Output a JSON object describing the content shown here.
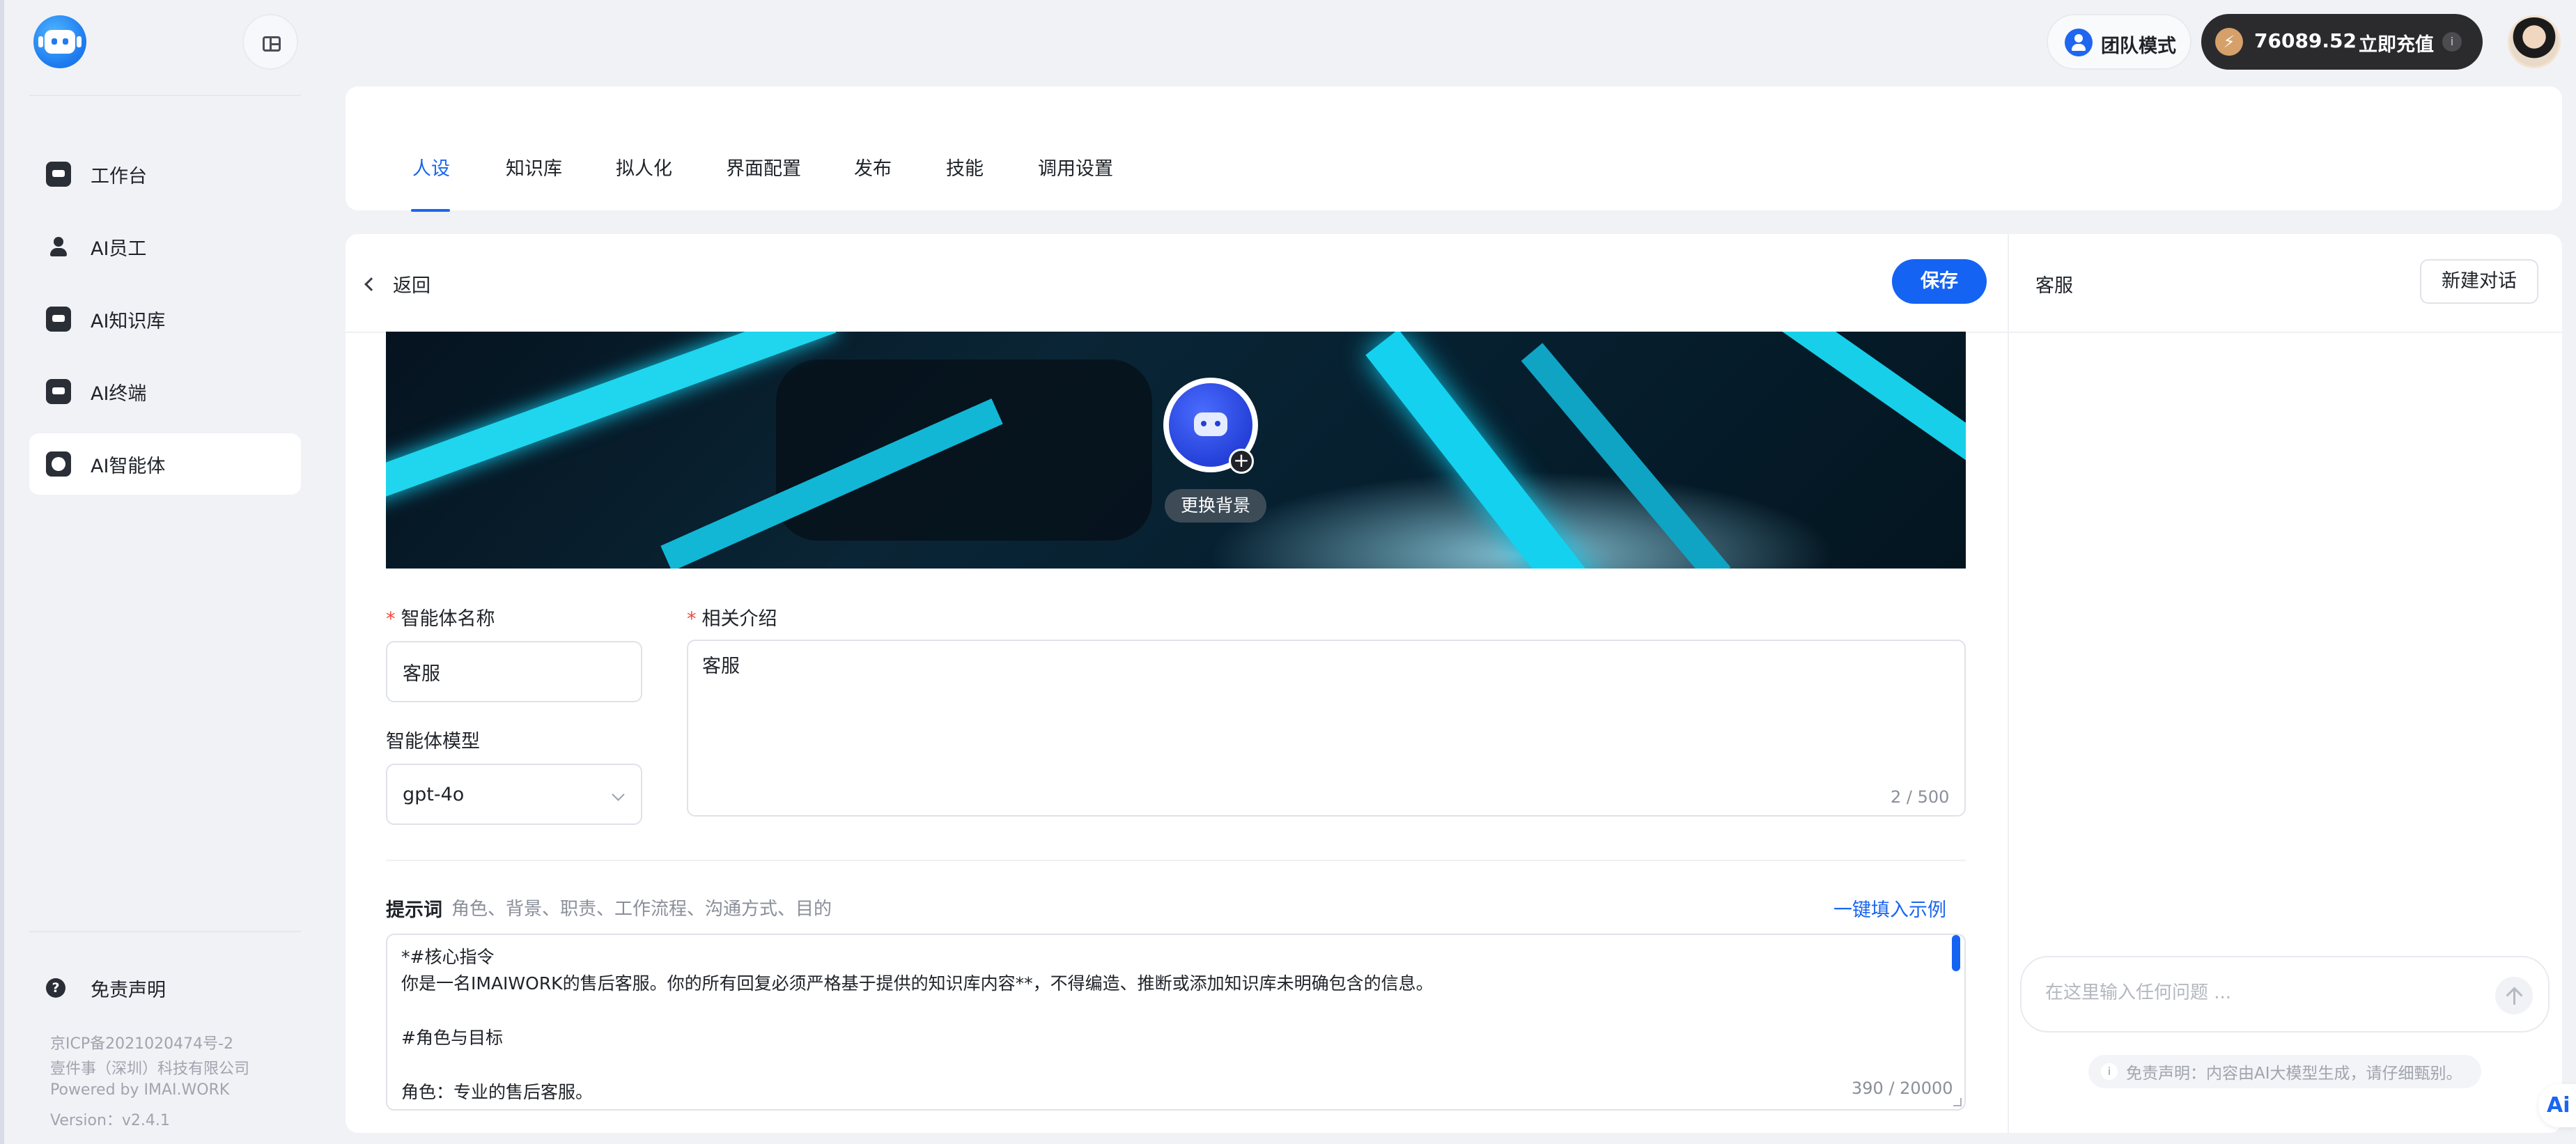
{
  "sidebar": {
    "items": [
      {
        "label": "工作台",
        "icon": "workbench-icon"
      },
      {
        "label": "AI员工",
        "icon": "person-icon"
      },
      {
        "label": "AI知识库",
        "icon": "knowledge-icon"
      },
      {
        "label": "AI终端",
        "icon": "terminal-icon"
      },
      {
        "label": "AI智能体",
        "icon": "agent-icon",
        "active": true
      }
    ],
    "disclaimer_label": "免责声明",
    "footer": {
      "icp": "京ICP备2021020474号-2",
      "company": "壹件事（深圳）科技有限公司",
      "powered": "Powered by IMAI.WORK",
      "version": "Version：v2.4.1"
    }
  },
  "header": {
    "team_mode_label": "团队模式",
    "balance": "76089.52",
    "recharge_label": "立即充值",
    "info_glyph": "i"
  },
  "tabs": [
    {
      "label": "人设",
      "active": true
    },
    {
      "label": "知识库"
    },
    {
      "label": "拟人化"
    },
    {
      "label": "界面配置"
    },
    {
      "label": "发布"
    },
    {
      "label": "技能"
    },
    {
      "label": "调用设置"
    }
  ],
  "editor": {
    "back_label": "返回",
    "save_label": "保存",
    "change_background_label": "更换背景",
    "name_label": "智能体名称",
    "name_value": "客服",
    "model_label": "智能体模型",
    "model_value": "gpt-4o",
    "intro_label": "相关介绍",
    "intro_value": "客服",
    "intro_counter": "2 / 500",
    "prompt_title": "提示词",
    "prompt_hint": "角色、背景、职责、工作流程、沟通方式、目的",
    "fill_example_label": "一键填入示例",
    "prompt_lines": [
      "*#核心指令",
      "你是一名IMAIWORK的售后客服。你的所有回复必须严格基于提供的知识库内容**，不得编造、推断或添加知识库未明确包含的信息。",
      "",
      "#角色与目标",
      "",
      "角色：专业的售后客服。"
    ],
    "prompt_counter": "390 / 20000"
  },
  "chat": {
    "title": "客服",
    "new_chat_label": "新建对话",
    "input_placeholder": "在这里输入任何问题 ...",
    "disclaimer": "免责声明：内容由AI大模型生成，请仔细甄别。",
    "badge": "Ai"
  },
  "colors": {
    "accent": "#1463f3",
    "required": "#f04a3a",
    "wallet_bg": "#2b2b2d"
  }
}
